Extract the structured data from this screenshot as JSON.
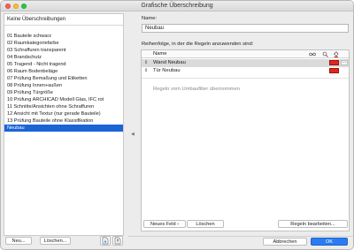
{
  "window": {
    "title": "Grafische Überschreibung"
  },
  "left": {
    "header": "Keine Überschreibungen",
    "items": [
      "01 Bauteile schwarz",
      "02 Raumkategoriefarbe",
      "03 Schraffuren transparent",
      "04 Brandschutz",
      "05 Tragend - Nicht tragend",
      "06 Raum Bodenbeläge",
      "07 Prüfung Bemaßung und Etiketten",
      "08 Prüfung Innen+außen",
      "09 Prüfung Türgröße",
      "10 Prüfung ARCHICAD Modell Glas, IFC rot",
      "11 Schnitte/Ansichten ohne Schraffuren",
      "12 Ansicht mit Textur (nur gerade Bauteile)",
      "13 Prüfung Bauteile ohne Klassifikation",
      "Neubau"
    ],
    "selected_index": 13,
    "new_label": "Neu...",
    "delete_label": "Löschen..."
  },
  "right": {
    "name_label": "Name:",
    "name_value": "Neubau",
    "order_label": "Reihenfolge, in der die Regeln anzuwenden sind:",
    "table": {
      "col_name": "Name",
      "rows": [
        {
          "name": "Wand Neubau",
          "swatch_color": "#e8241a",
          "more": "..."
        },
        {
          "name": "Tür Neubau",
          "swatch_color": "#e8241a",
          "more": ""
        }
      ],
      "placeholder_rule": "Regeln vom Umbaufilter übernommen"
    },
    "new_field_label": "Neues Feld",
    "delete_label": "Löschen",
    "edit_rules_label": "Regeln bearbeiten...",
    "cancel_label": "Abbrechen",
    "ok_label": "OK"
  },
  "colors": {
    "selection": "#1a64d6",
    "ok_button": "#2b7cf2",
    "swatch_red": "#e8241a"
  }
}
